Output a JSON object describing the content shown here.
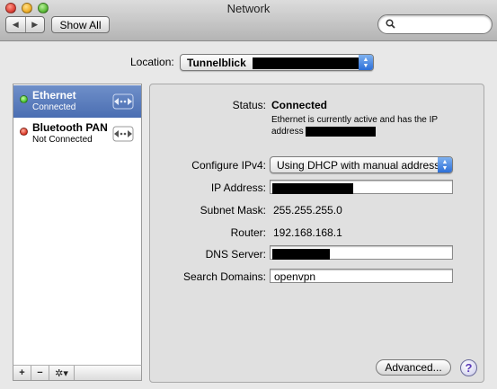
{
  "window": {
    "title": "Network"
  },
  "toolbar": {
    "back_glyph": "◀",
    "forward_glyph": "▶",
    "show_all_label": "Show All",
    "search_placeholder": ""
  },
  "location": {
    "label": "Location:",
    "value": "Tunnelblick"
  },
  "services": [
    {
      "name": "Ethernet",
      "status": "Connected",
      "state_color": "#3cbb2a",
      "selected": true,
      "icon": "ethernet-icon"
    },
    {
      "name": "Bluetooth PAN",
      "status": "Not Connected",
      "state_color": "#d8301f",
      "selected": false,
      "icon": "bluetooth-pan-icon"
    }
  ],
  "services_footer": {
    "add": "+",
    "remove": "−",
    "action": "✲▾"
  },
  "detail": {
    "status_label": "Status:",
    "status_value": "Connected",
    "status_description": "Ethernet is currently active and has the IP address",
    "configure_label": "Configure IPv4:",
    "configure_value": "Using DHCP with manual address",
    "ip_label": "IP Address:",
    "ip_value": "",
    "subnet_label": "Subnet Mask:",
    "subnet_value": "255.255.255.0",
    "router_label": "Router:",
    "router_value": "192.168.168.1",
    "dns_label": "DNS Server:",
    "dns_value": "",
    "search_domains_label": "Search Domains:",
    "search_domains_value": "openvpn"
  },
  "buttons": {
    "advanced": "Advanced...",
    "help": "?"
  },
  "colors": {
    "selection": "#4a6eb2",
    "popup_arrows": "#2d6fd8"
  }
}
